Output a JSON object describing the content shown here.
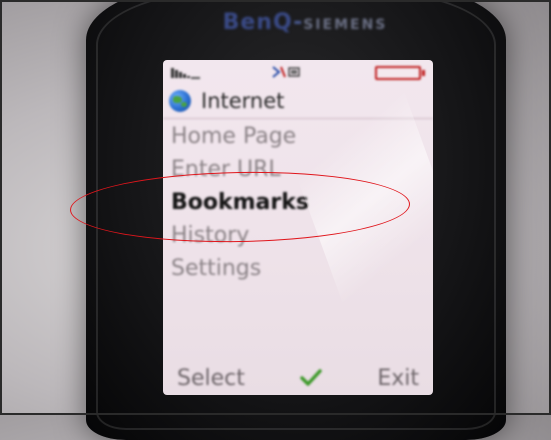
{
  "device": {
    "brand_part1": "BenQ",
    "brand_part2": "SIEMENS"
  },
  "screen": {
    "title": "Internet",
    "menu_items": [
      {
        "label": "Home Page",
        "selected": false
      },
      {
        "label": "Enter URL",
        "selected": false
      },
      {
        "label": "Bookmarks",
        "selected": true
      },
      {
        "label": "History",
        "selected": false
      },
      {
        "label": "Settings",
        "selected": false
      }
    ],
    "softkeys": {
      "left": "Select",
      "right": "Exit"
    }
  },
  "colors": {
    "annotation": "#e0161c",
    "battery": "#c02020",
    "screen_background": "#efe3ea"
  },
  "icons": {
    "title": "globe-icon",
    "center_softkey": "check-icon",
    "status": [
      "signal-icon",
      "network-icon",
      "battery-icon"
    ]
  }
}
